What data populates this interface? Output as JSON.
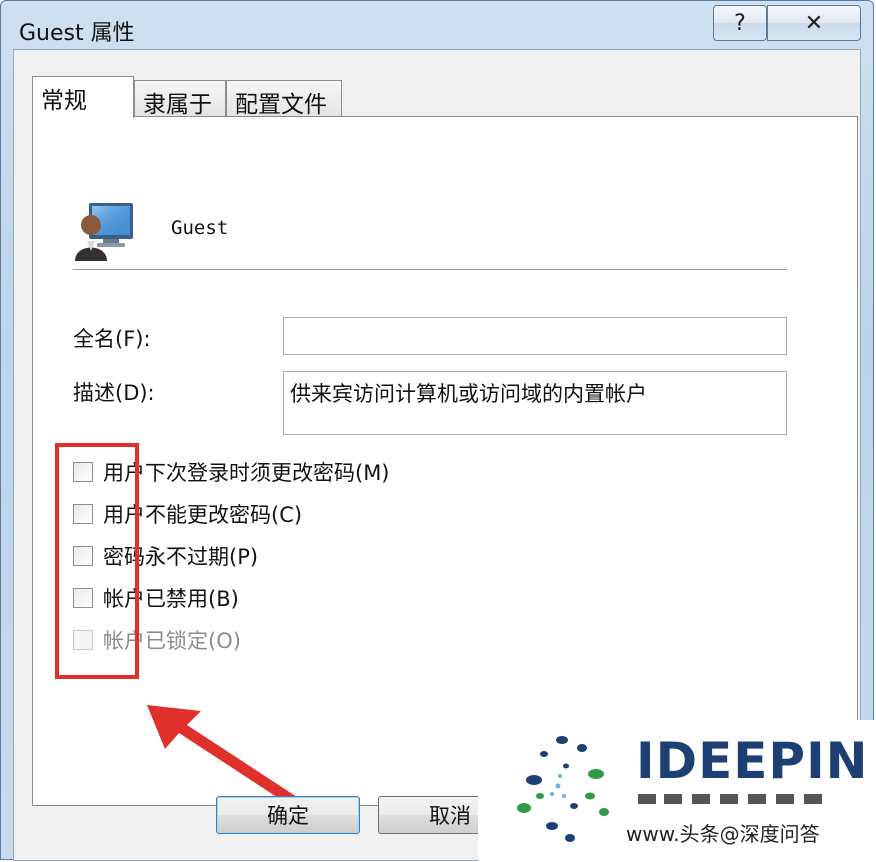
{
  "window": {
    "title": "Guest 属性",
    "help_glyph": "?",
    "close_glyph": "✕"
  },
  "tabs": [
    {
      "label": "常规",
      "active": true
    },
    {
      "label": "隶属于",
      "active": false
    },
    {
      "label": "配置文件",
      "active": false
    }
  ],
  "general": {
    "user_icon": "user-computer-icon",
    "username": "Guest",
    "fullname_label": "全名(F):",
    "fullname_value": "",
    "description_label": "描述(D):",
    "description_value": "供来宾访问计算机或访问域的内置帐户",
    "checkboxes": [
      {
        "label": "用户下次登录时须更改密码(M)",
        "checked": false,
        "disabled": false
      },
      {
        "label": "用户不能更改密码(C)",
        "checked": false,
        "disabled": false
      },
      {
        "label": "密码永不过期(P)",
        "checked": false,
        "disabled": false
      },
      {
        "label": "帐户已禁用(B)",
        "checked": false,
        "disabled": false
      },
      {
        "label": "帐户已锁定(O)",
        "checked": false,
        "disabled": true
      }
    ]
  },
  "buttons": {
    "ok": "确定",
    "cancel": "取消"
  },
  "annotation": {
    "box_color": "#e0302c",
    "arrow_color": "#e0302c"
  },
  "watermark": {
    "logo_text": "IDEEPIN",
    "url_text": "www.头条@深度问答"
  }
}
